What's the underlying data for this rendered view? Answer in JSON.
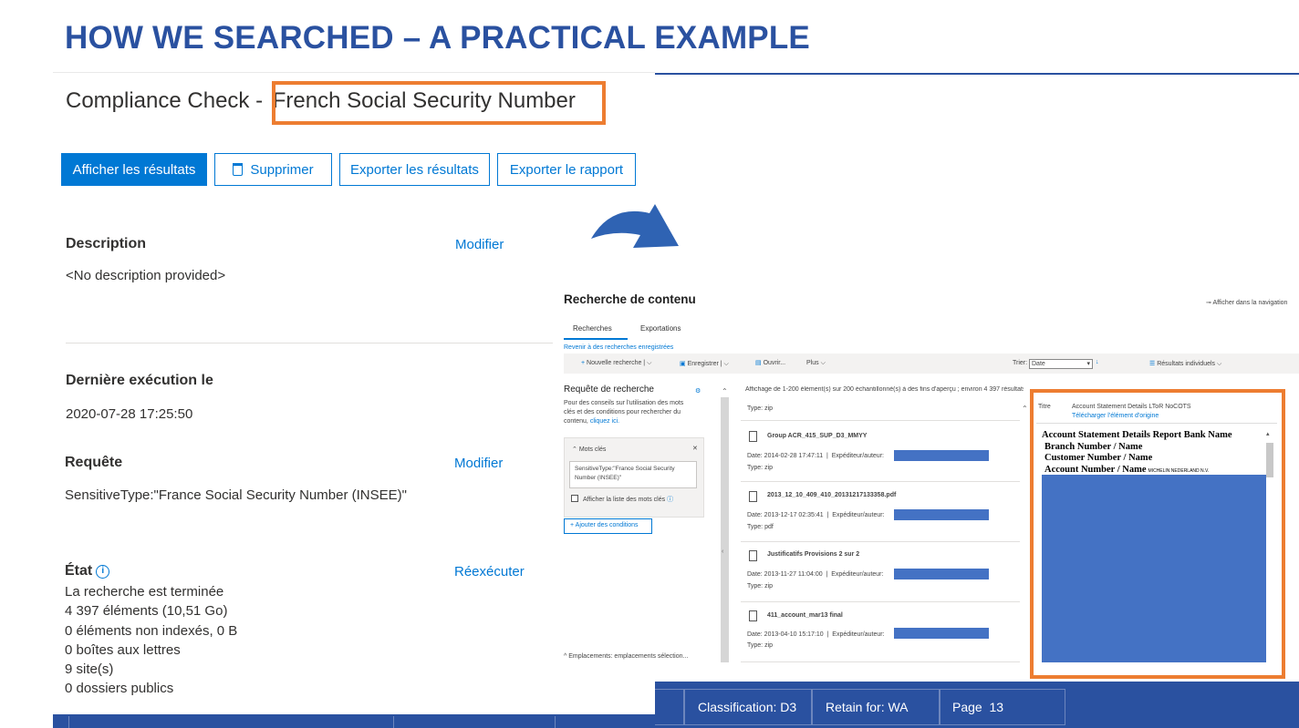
{
  "slide_title": "HOW WE SEARCHED – A PRACTICAL EXAMPLE",
  "compliance": {
    "title_prefix": "Compliance Check - ",
    "title_highlight": "French Social Security Number"
  },
  "buttons": {
    "show_results": "Afficher les résultats",
    "delete": "Supprimer",
    "export_results": "Exporter les résultats",
    "export_report": "Exporter le rapport"
  },
  "description": {
    "label": "Description",
    "edit": "Modifier",
    "value": "<No description provided>"
  },
  "last_run": {
    "label": "Dernière exécution le",
    "value": "2020-07-28 17:25:50"
  },
  "query": {
    "label": "Requête",
    "edit": "Modifier",
    "value": "SensitiveType:\"France Social Security Number (INSEE)\""
  },
  "state": {
    "label": "État",
    "rerun": "Réexécuter",
    "lines": [
      "La recherche est terminée",
      "4 397 éléments (10,51 Go)",
      "0 éléments non indexés, 0 B",
      "0 boîtes aux lettres",
      "9 site(s)",
      "0 dossiers publics"
    ]
  },
  "content_search": {
    "title": "Recherche de contenu",
    "show_in_nav": "Afficher dans la navigation",
    "tabs": [
      "Recherches",
      "Exportations"
    ],
    "back_link": "Revenir à des recherches enregistrées",
    "toolbar": {
      "new_search": "Nouvelle recherche",
      "save": "Enregistrer",
      "open": "Ouvrir...",
      "more": "Plus",
      "sort_label": "Trier:",
      "sort_value": "Date",
      "view": "Résultats individuels"
    },
    "results_summary": "Affichage de 1-200 élément(s) sur 200 échantillonné(s) à des fins d'aperçu ; environ 4 397 résultats",
    "query_panel": {
      "title": "Requête de recherche",
      "help": [
        "Pour des conseils sur l'utilisation des mots",
        "clés et des conditions pour rechercher du",
        "contenu,"
      ],
      "help_link": "cliquez ici.",
      "keywords_label": "Mots clés",
      "keywords_value": [
        "SensitiveType:\"France Social Security",
        "Number (INSEE)\""
      ],
      "show_keywords_list": "Afficher la liste des mots clés",
      "add_conditions": "Ajouter des conditions",
      "locations": "Emplacements: emplacements sélection..."
    },
    "results": [
      {
        "name": "",
        "date": "",
        "type": "Type: zip"
      },
      {
        "name": "Group ACR_415_SUP_D3_MMYY",
        "date": "Date: 2014-02-28 17:47:11",
        "sender": "Expéditeur/auteur:",
        "type": "Type: zip"
      },
      {
        "name": "2013_12_10_409_410_20131217133358.pdf",
        "date": "Date: 2013-12-17 02:35:41",
        "sender": "Expéditeur/auteur:",
        "type": "Type: pdf"
      },
      {
        "name": "Justificatifs Provisions 2 sur 2",
        "date": "Date: 2013-11-27 11:04:00",
        "sender": "Expéditeur/auteur:",
        "type": "Type: zip"
      },
      {
        "name": "411_account_mar13 final",
        "date": "Date: 2013-04-10 15:17:10",
        "sender": "Expéditeur/auteur:",
        "type": "Type: zip"
      }
    ],
    "preview": {
      "title_label": "Titre",
      "title_value": "Account Statement Details LToR NoCOTS",
      "download": "Télécharger l'élément d'origine",
      "doc_lines": [
        "Account Statement Details Report Bank Name",
        "Branch Number / Name",
        "Customer Number / Name",
        "Account Number / Name"
      ],
      "doc_small": "MICHELIN NEDERLAND N.V."
    }
  },
  "footer": {
    "classification": "Classification: D3",
    "retain": "Retain for: WA",
    "page_label": "Page",
    "page_number": "13"
  },
  "colors": {
    "title_blue": "#2a51a0",
    "accent_orange": "#ed7d31",
    "ms_blue": "#0078d4",
    "redaction_blue": "#4472c4"
  }
}
